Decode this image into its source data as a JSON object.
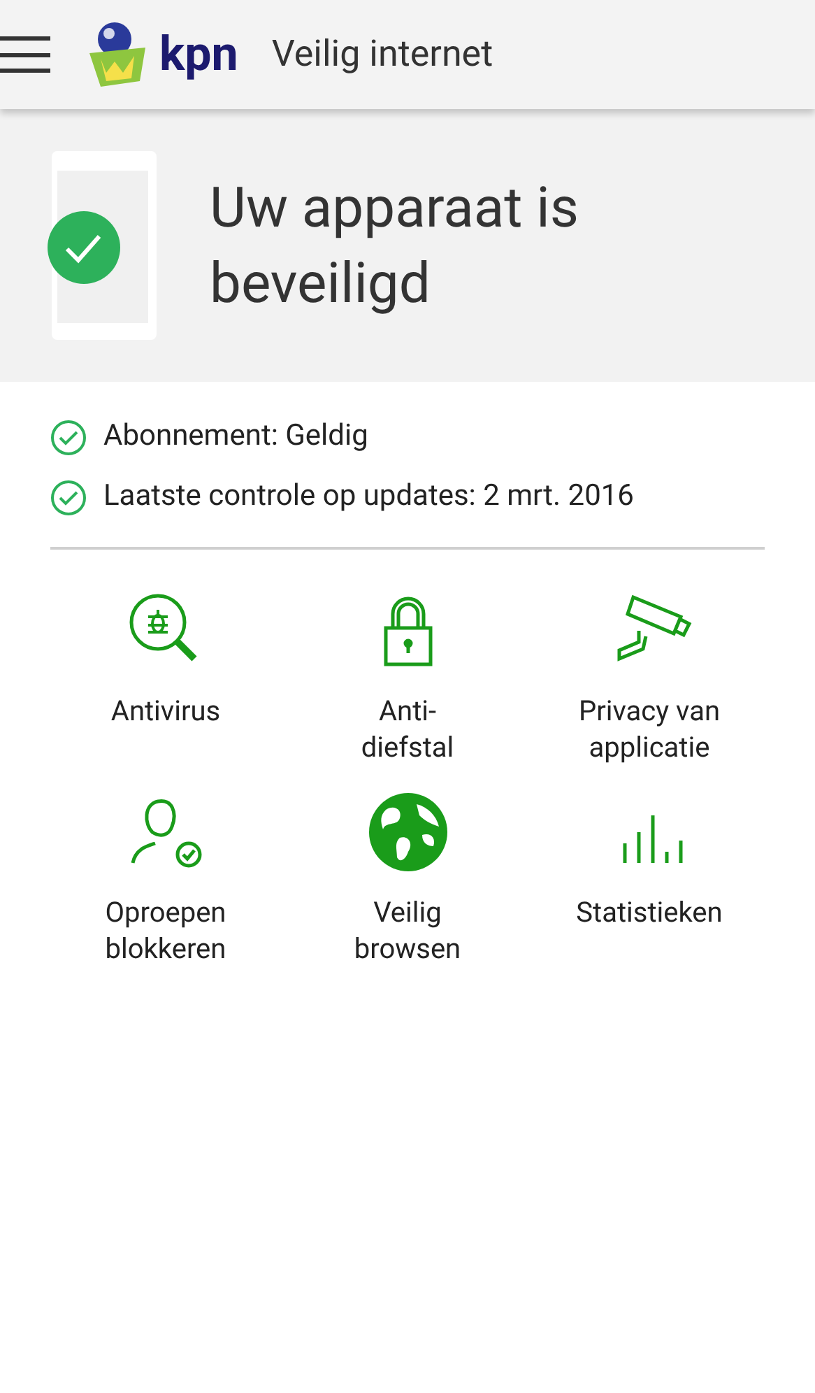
{
  "header": {
    "logo_text": "kpn",
    "title": "Veilig internet"
  },
  "status": {
    "title": "Uw apparaat is beveiligd"
  },
  "checks": [
    "Abonnement: Geldig",
    "Laatste controle op updates: 2 mrt. 2016"
  ],
  "features": [
    {
      "lines": [
        "Antivirus"
      ]
    },
    {
      "lines": [
        "Anti-",
        "diefstal"
      ]
    },
    {
      "lines": [
        "Privacy van",
        "applicatie"
      ]
    },
    {
      "lines": [
        "Oproepen",
        "blokkeren"
      ]
    },
    {
      "lines": [
        "Veilig",
        "browsen"
      ]
    },
    {
      "lines": [
        "Statistieken"
      ]
    }
  ]
}
